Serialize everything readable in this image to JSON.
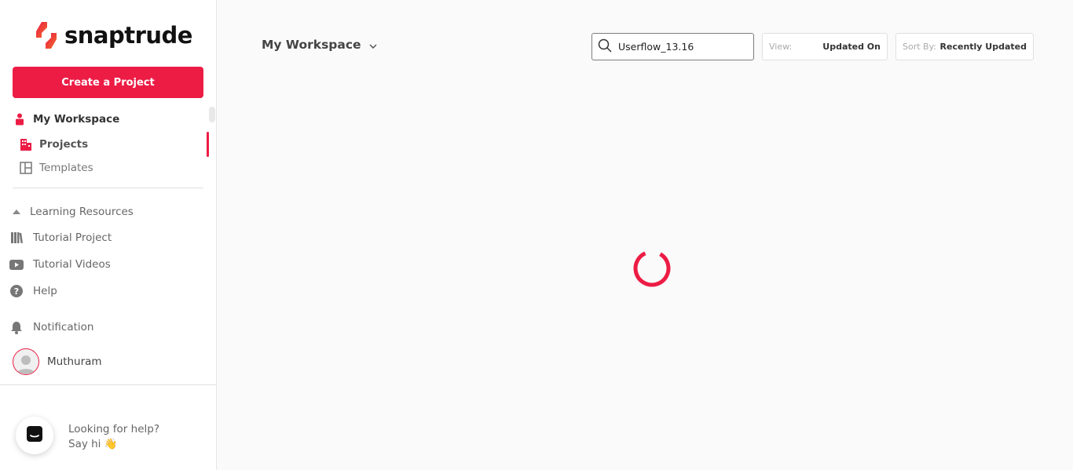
{
  "brand": {
    "name": "snaptrude",
    "accent": "#ec1c45"
  },
  "sidebar": {
    "create_button": "Create a Project",
    "workspace_label": "My Workspace",
    "items": [
      {
        "label": "Projects",
        "icon": "building-icon",
        "active": true
      },
      {
        "label": "Templates",
        "icon": "template-icon",
        "active": false
      }
    ],
    "learning_header": "Learning Resources",
    "learning_items": [
      {
        "label": "Tutorial Project",
        "icon": "books-icon"
      },
      {
        "label": "Tutorial Videos",
        "icon": "youtube-icon"
      },
      {
        "label": "Help",
        "icon": "help-icon"
      }
    ],
    "notification_label": "Notification",
    "user_name": "Muthuram"
  },
  "chat": {
    "line1": "Looking for help?",
    "line2": "Say hi 👋"
  },
  "main": {
    "title": "My Workspace",
    "search_value": "Userflow_13.16",
    "view": {
      "label": "View:",
      "value": "Updated On"
    },
    "sort": {
      "label": "Sort By:",
      "value": "Recently Updated"
    },
    "loading": true
  }
}
